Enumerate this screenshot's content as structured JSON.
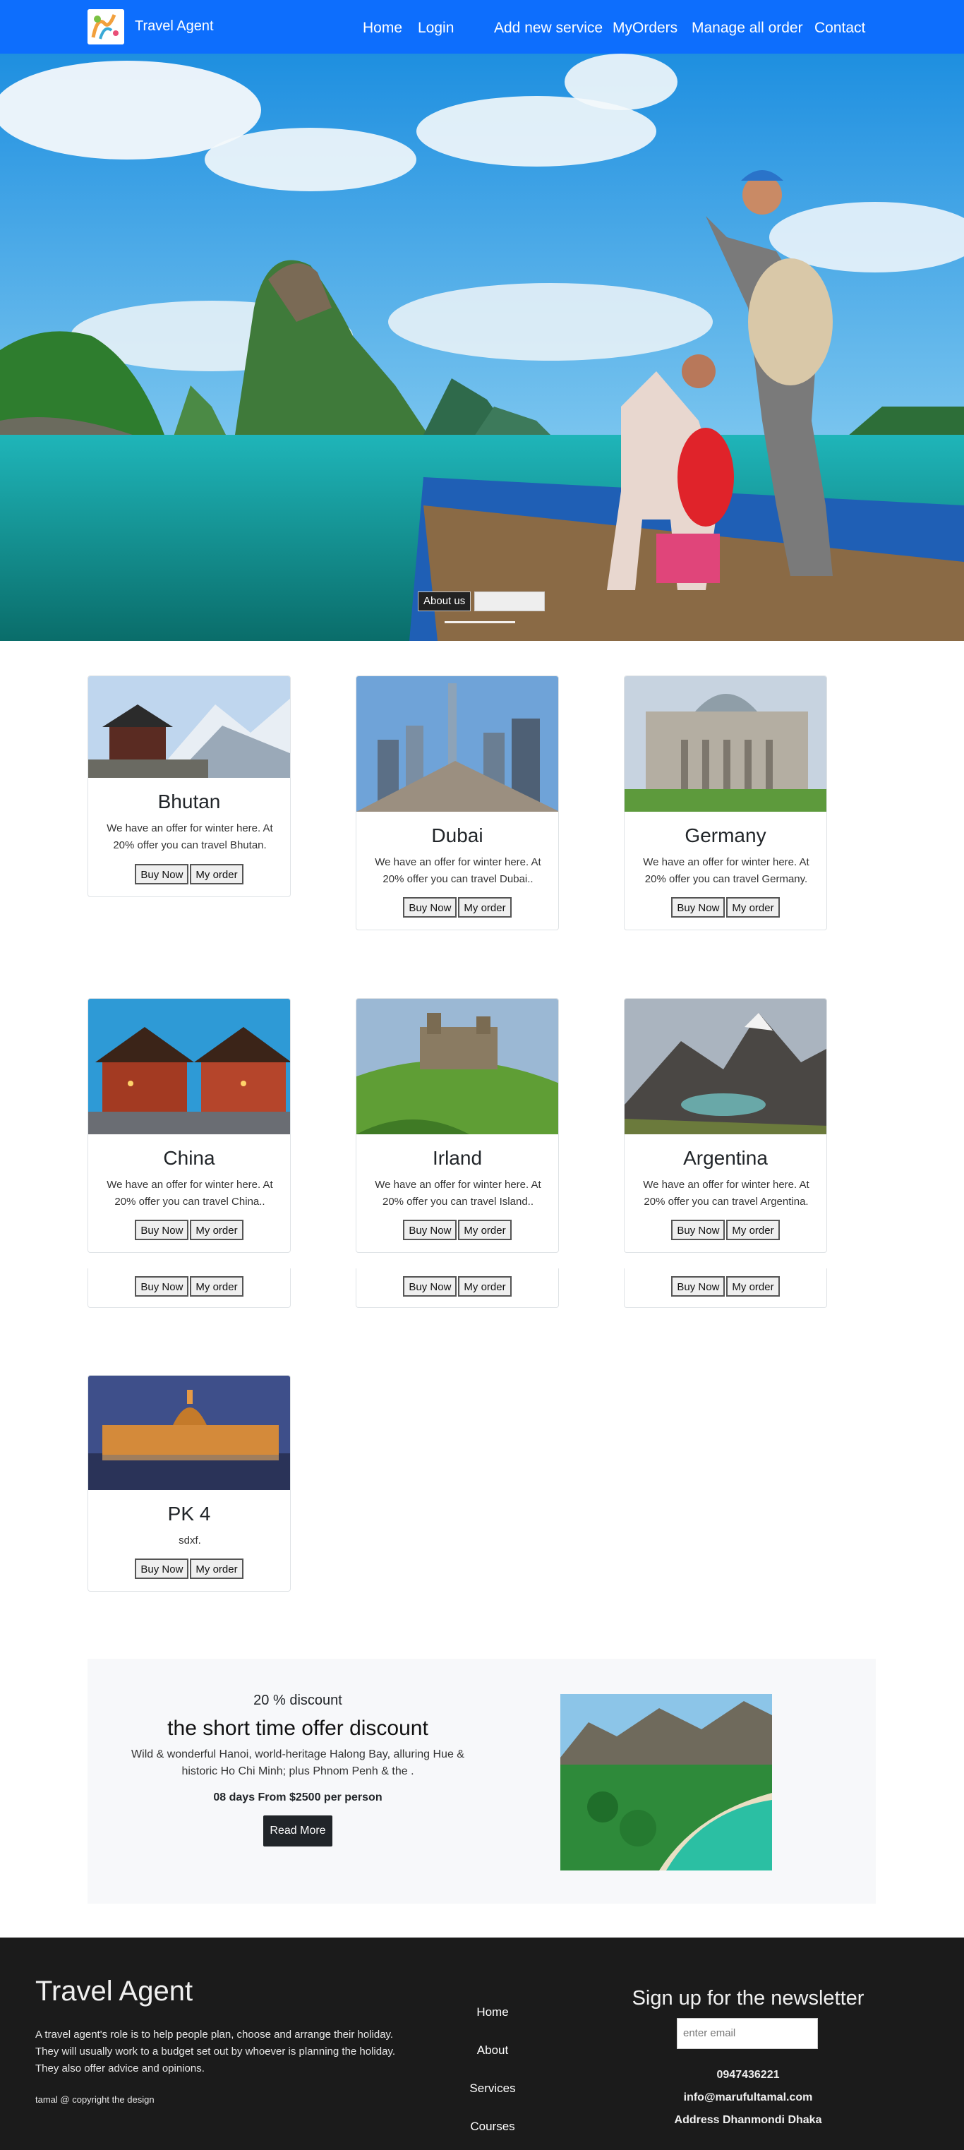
{
  "navbar": {
    "brand": "Travel Agent",
    "links": [
      "Home",
      "Login",
      "Add new service",
      "MyOrders",
      "Manage all order",
      "Contact"
    ]
  },
  "hero": {
    "about_label": "About us",
    "blank_label": ""
  },
  "services": [
    {
      "title": "Bhutan",
      "text": "We have an offer for winter here. At 20% offer you can travel Bhutan."
    },
    {
      "title": "Dubai",
      "text": "We have an offer for winter here. At 20% offer you can travel Dubai.."
    },
    {
      "title": "Germany",
      "text": "We have an offer for winter here. At 20% offer you can travel Germany."
    },
    {
      "title": "China",
      "text": "We have an offer for winter here. At 20% offer you can travel China.."
    },
    {
      "title": "Irland",
      "text": "We have an offer for winter here. At 20% offer you can travel Island.."
    },
    {
      "title": "Argentina",
      "text": "We have an offer for winter here. At 20% offer you can travel Argentina."
    },
    {
      "title": "PK 4",
      "text": "sdxf."
    }
  ],
  "buttons": {
    "buy": "Buy Now",
    "order": "My order"
  },
  "offer": {
    "discount": "20 % discount",
    "title": "the short time offer discount",
    "description": "Wild & wonderful Hanoi, world-heritage Halong Bay, alluring Hue & historic Ho Chi Minh; plus Phnom Penh & the .",
    "price": "08 days From $2500 per person",
    "button": "Read More"
  },
  "footer": {
    "brand": "Travel Agent",
    "about": "A travel agent's role is to help people plan, choose and arrange their holiday. They will usually work to a budget set out by whoever is planning the holiday. They also offer advice and opinions.",
    "copyright": "tamal @ copyright the design",
    "links": [
      "Home",
      "About",
      "Services",
      "Courses"
    ],
    "newsletter_title": "Sign up for the newsletter",
    "email_placeholder": "enter email",
    "phone": "0947436221",
    "email": "info@marufultamal.com",
    "address": "Address Dhanmondi Dhaka"
  }
}
